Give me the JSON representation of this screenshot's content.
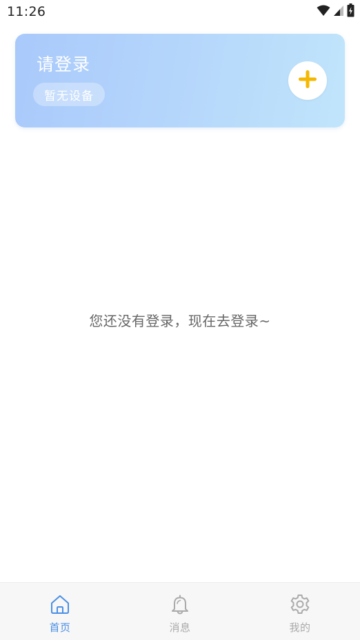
{
  "status_bar": {
    "time": "11:26",
    "icons": [
      "wifi-icon",
      "signal-icon",
      "battery-icon"
    ]
  },
  "header": {
    "title": "请登录",
    "device_badge": "暂无设备",
    "add_icon": "plus-icon",
    "accent_color": "#f5b800"
  },
  "main": {
    "empty_message": "您还没有登录，现在去登录~"
  },
  "tabbar": {
    "active_color": "#4a8fe6",
    "inactive_color": "#aaaaaa",
    "items": [
      {
        "label": "首页",
        "icon": "home-icon",
        "active": true
      },
      {
        "label": "消息",
        "icon": "bell-icon",
        "active": false
      },
      {
        "label": "我的",
        "icon": "gear-icon",
        "active": false
      }
    ]
  }
}
